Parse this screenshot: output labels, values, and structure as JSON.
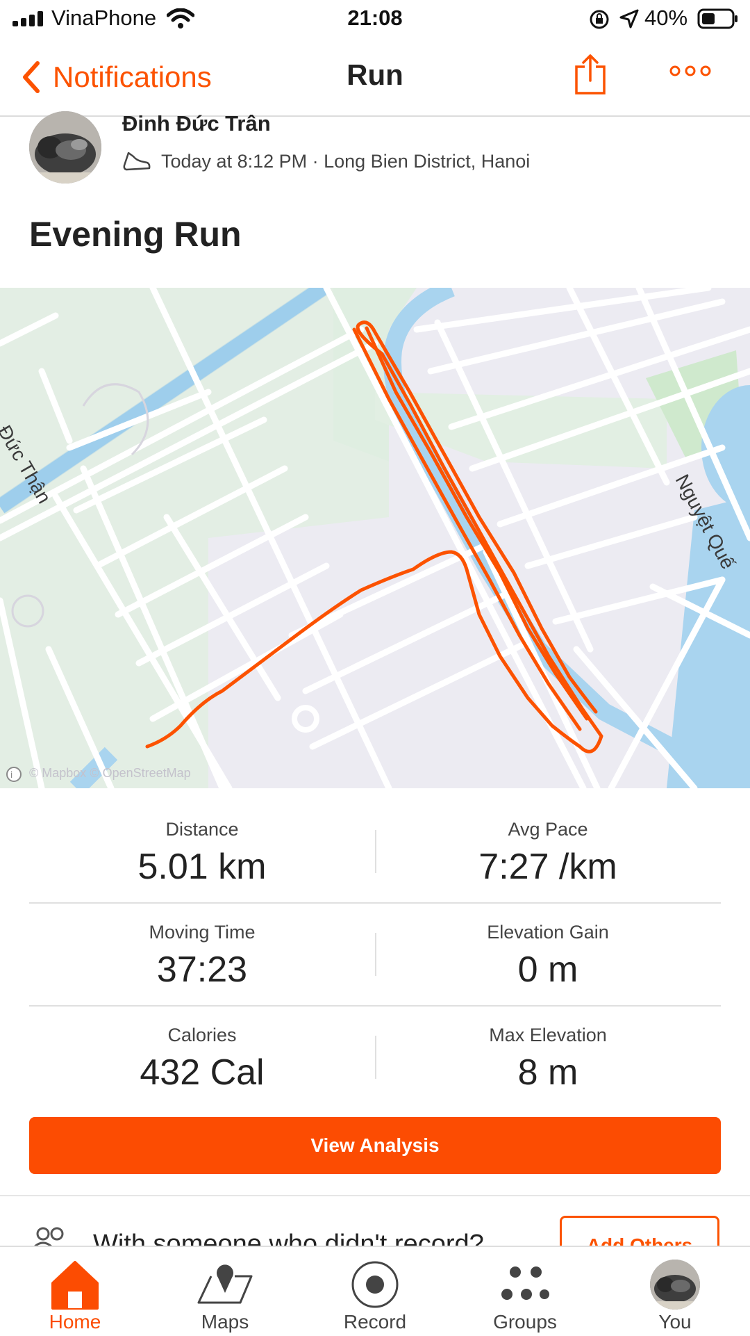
{
  "status_bar": {
    "carrier": "VinaPhone",
    "time": "21:08",
    "battery": "40%"
  },
  "nav": {
    "back_label": "Notifications",
    "title": "Run",
    "share_icon": "share-icon",
    "more_icon": "more-icon"
  },
  "activity": {
    "athlete_name": "Đinh Đức Trân",
    "meta": "Today at 8:12 PM · Long Bien District, Hanoi",
    "title": "Evening Run"
  },
  "map": {
    "street_labels": [
      "Đức Thận",
      "Nguyệt Quế"
    ],
    "attribution": "© Mapbox © OpenStreetMap",
    "route_color": "#fc5200",
    "water_color": "#a9d4ef"
  },
  "stats": [
    [
      {
        "label": "Distance",
        "value": "5.01 km"
      },
      {
        "label": "Avg Pace",
        "value": "7:27 /km"
      }
    ],
    [
      {
        "label": "Moving Time",
        "value": "37:23"
      },
      {
        "label": "Elevation Gain",
        "value": "0 m"
      }
    ],
    [
      {
        "label": "Calories",
        "value": "432 Cal"
      },
      {
        "label": "Max Elevation",
        "value": "8 m"
      }
    ]
  ],
  "analysis_button": "View Analysis",
  "others": {
    "text": "With someone who didn't record?",
    "button": "Add Others"
  },
  "tabs": [
    {
      "label": "Home",
      "icon": "home-icon",
      "active": true
    },
    {
      "label": "Maps",
      "icon": "maps-icon",
      "active": false
    },
    {
      "label": "Record",
      "icon": "record-icon",
      "active": false
    },
    {
      "label": "Groups",
      "icon": "groups-icon",
      "active": false
    },
    {
      "label": "You",
      "icon": "avatar",
      "active": false
    }
  ],
  "colors": {
    "accent": "#fc4c02",
    "text": "#222222"
  }
}
